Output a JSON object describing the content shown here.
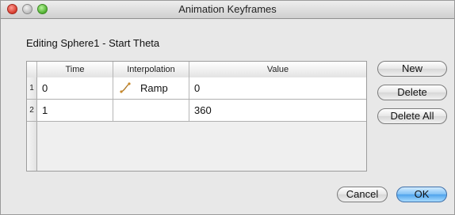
{
  "window": {
    "title": "Animation Keyframes"
  },
  "heading": "Editing Sphere1 - Start Theta",
  "table": {
    "columns": [
      "Time",
      "Interpolation",
      "Value"
    ],
    "rows": [
      {
        "num": "1",
        "time": "0",
        "interpolation": "Ramp",
        "value": "0"
      },
      {
        "num": "2",
        "time": "1",
        "interpolation": "",
        "value": "360"
      }
    ]
  },
  "buttons": {
    "new": "New",
    "delete": "Delete",
    "delete_all": "Delete All",
    "cancel": "Cancel",
    "ok": "OK"
  },
  "colors": {
    "ok_button": "#4fa3ec",
    "close_light": "#d53a2c",
    "zoom_light": "#4fae2f"
  },
  "icons": {
    "interpolation": "ramp-curve-icon"
  }
}
